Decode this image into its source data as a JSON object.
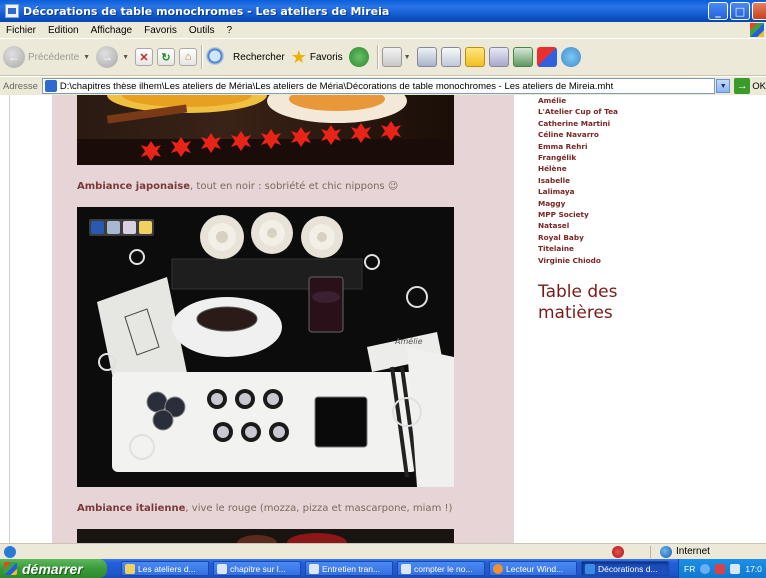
{
  "window": {
    "title": "Décorations de table monochromes - Les ateliers de Mireia",
    "controls": {
      "minimize": "_",
      "maximize": "□"
    }
  },
  "menu": [
    "Fichier",
    "Edition",
    "Affichage",
    "Favoris",
    "Outils",
    "?"
  ],
  "toolbar": {
    "back_label": "Précédente",
    "search_label": "Rechercher",
    "favorites_label": "Favoris"
  },
  "address": {
    "label": "Adresse",
    "value": "D:\\chapitres thèse ilhem\\Les ateliers de Méria\\Les ateliers de Méria\\Décorations de table monochromes - Les ateliers de Mireia.mht",
    "go_label": "OK"
  },
  "post": {
    "caption_japanese_bold": "Ambiance japonaise",
    "caption_japanese_rest": ", tout en noir : sobriété et chic nippons",
    "caption_japanese_emoji": "😉",
    "caption_italian_bold": "Ambiance italienne",
    "caption_italian_rest": ", vive le rouge (mozza, pizza et mascarpone, miam !)",
    "place_card_name": "Amélie"
  },
  "sidebar": {
    "links": [
      "Amélie",
      "L'Atelier Cup of Tea",
      "Catherine Martini",
      "Céline Navarro",
      "Emma Rehri",
      "Frangélik",
      "Hélène",
      "Isabelle",
      "Lalimaya",
      "Maggy",
      "MPP Society",
      "Natasel",
      "Royal Baby",
      "Titelaine",
      "Virginie Chiodo"
    ],
    "section_title": "Table des matières"
  },
  "status": {
    "zone": "Internet"
  },
  "taskbar": {
    "start_label": "démarrer",
    "tasks": [
      "Les ateliers d...",
      "chapitre sur l...",
      "Entretien tran...",
      "compter le no...",
      "Lecteur Wind...",
      "Décorations d..."
    ],
    "active_index": 5,
    "lang": "FR",
    "clock": "17:0"
  },
  "colors": {
    "post_bg": "#e6d4d6",
    "caption_bold": "#7a3a3a",
    "sidebar_link": "#7a2424",
    "section_title": "#7a1a1a",
    "titlebar": "#0a52c8",
    "start_button": "#3a9a3a"
  }
}
